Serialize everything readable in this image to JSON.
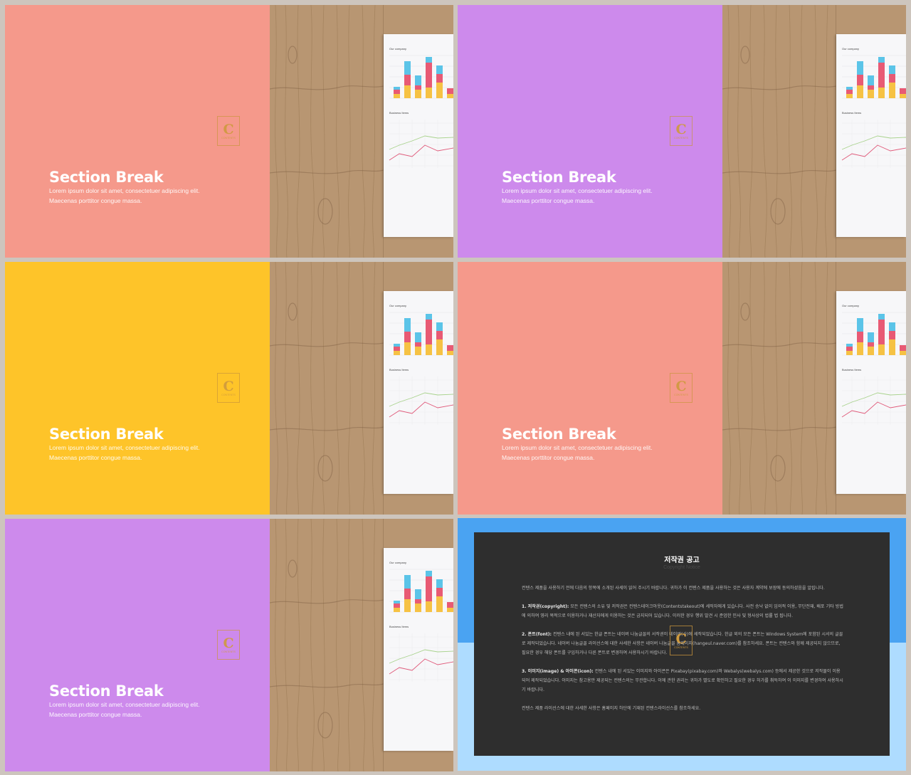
{
  "slides": [
    {
      "title": "Section Break",
      "subtitle": "Lorem ipsum dolor sit amet, consectetuer adipiscing elit. Maecenas porttitor congue massa.",
      "color": "#f5998b"
    },
    {
      "title": "Section Break",
      "subtitle": "Lorem ipsum dolor sit amet, consectetuer adipiscing elit. Maecenas porttitor congue massa.",
      "color": "#cd8aec"
    },
    {
      "title": "Section Break",
      "subtitle": "Lorem ipsum dolor sit amet, consectetuer adipiscing elit. Maecenas porttitor congue massa.",
      "color": "#fec429"
    },
    {
      "title": "Section Break",
      "subtitle": "Lorem ipsum dolor sit amet, consectetuer adipiscing elit. Maecenas porttitor congue massa.",
      "color": "#f5998b"
    },
    {
      "title": "Section Break",
      "subtitle": "Lorem ipsum dolor sit amet, consectetuer adipiscing elit. Maecenas porttitor congue massa.",
      "color": "#cd8aec"
    }
  ],
  "paper": {
    "bar_chart_label": "Our company",
    "line_chart_label": "Business Items"
  },
  "logo": {
    "icon": "contents-logo-icon",
    "letter": "C",
    "text": "CONTENTS"
  },
  "notice": {
    "title": "저작권 공고",
    "subtitle": "Copyright Notice",
    "intro": "컨텐스 제품을 사용하기 전에 다음의 항목에 소개된 사세이 읽어 주시기 바랍니다. 귀하가 이 컨텐스 제품을 사용하는 것은 사용자 계약에 보장에 동의하셨음을 알립니다.",
    "items": [
      {
        "label": "1. 저작권(copyright):",
        "text": "모든 컨텐스의 소유 및 저작권은 컨텐스테이크아웃(Contentstakeout)에 세작자에게 있습니다. 사전 승낙 없이 임의적 이용, 무단전재, 배포 기타 방법에 의하여 영리 목적으로 이용하거나 재산자에게 이용하는 것은 금지되어 있습니다. 이러한 경우 행위 발견 시 준엄한 민사 및 형사상의 법률 법 됩니다."
      },
      {
        "label": "2. 폰트(font):",
        "text": "컨텐스 내에 된 서있는 한글 폰트는 네이버 나눔글꼴의 서작권이 네이버(사)에 세작되었습니다. 한글 외의 모든 폰트는 Windows System에 포함된 시서의 글꼴로 제작되었습니다. 네이버 나눔글꼴 라이선스에 대한 사세한 사항은 네이버 나눔글꼴 홈페이지(hangeul.naver.com)를 참조하세요. 폰트는 컨텐스와 함께 제공되지 않으므로, 필요한 경우 해당 폰트를 구입하거나 다른 폰트로 변경하여 사용하시기 바랍니다."
      },
      {
        "label": "3. 이미지(image) & 아이콘(icon):",
        "text": "컨텐스 내에 된 서있는 이미지와 아이콘은 Pixabay(pixabay.com)와 Webalys(webalys.com) 등에서 제공한 것으로 저작물이 이용되어 제작되었습니다. 이미지는 참고용만 제공되는 컨텐스의는 무관합니다. 이에 관한 권리는 귀하가 별도로 확인하고 필요한 경우 허가를 취득하여 이 이미지를 변경하여 사용하시기 바랍니다."
      }
    ],
    "outro": "컨텐스 제품 라이선스에 대한 사세한 사항은 홈페이지 하단에 기재된 컨텐스라이선스를 참조하세요.",
    "colors": {
      "top": "#4aa3f2",
      "bottom": "#aedcff",
      "card": "#2e2e2e"
    }
  }
}
